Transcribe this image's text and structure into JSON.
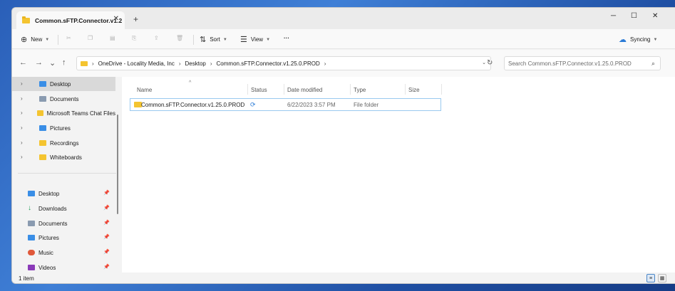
{
  "window": {
    "tab_title": "Common.sFTP.Connector.v1.2",
    "tab_close": "✕",
    "new_tab": "+",
    "minimize": "─",
    "maximize": "☐",
    "close": "✕"
  },
  "toolbar": {
    "new_label": "New",
    "sort_label": "Sort",
    "view_label": "View",
    "more": "···",
    "sync_label": "Syncing"
  },
  "address": {
    "crumbs": [
      "OneDrive - Locality Media, Inc",
      "Desktop",
      "Common.sFTP.Connector.v1.25.0.PROD"
    ],
    "search_placeholder": "Search Common.sFTP.Connector.v1.25.0.PROD"
  },
  "nav": {
    "tree": [
      {
        "label": "Desktop",
        "icon": "desktop-icon",
        "color": "#3a8ee6"
      },
      {
        "label": "Documents",
        "icon": "documents-icon",
        "color": "#8a9bb0"
      },
      {
        "label": "Microsoft Teams Chat Files",
        "icon": "folder-icon",
        "color": "#f4c430"
      },
      {
        "label": "Pictures",
        "icon": "pictures-icon",
        "color": "#3a8ee6"
      },
      {
        "label": "Recordings",
        "icon": "folder-icon",
        "color": "#f4c430"
      },
      {
        "label": "Whiteboards",
        "icon": "folder-icon",
        "color": "#f4c430"
      }
    ],
    "quick": [
      {
        "label": "Desktop",
        "icon": "desktop-icon",
        "color": "#3a8ee6"
      },
      {
        "label": "Downloads",
        "icon": "downloads-icon",
        "color": "#1f9d55"
      },
      {
        "label": "Documents",
        "icon": "documents-icon",
        "color": "#8a9bb0"
      },
      {
        "label": "Pictures",
        "icon": "pictures-icon",
        "color": "#3a8ee6"
      },
      {
        "label": "Music",
        "icon": "music-icon",
        "color": "#e0583a"
      },
      {
        "label": "Videos",
        "icon": "videos-icon",
        "color": "#8a3ab8"
      }
    ]
  },
  "columns": {
    "name": "Name",
    "status": "Status",
    "date": "Date modified",
    "type": "Type",
    "size": "Size"
  },
  "files": [
    {
      "name": "Common.sFTP.Connector.v1.25.0.PROD",
      "date": "6/22/2023 3:57 PM",
      "type": "File folder",
      "size": ""
    }
  ],
  "status": {
    "count": "1 item"
  }
}
